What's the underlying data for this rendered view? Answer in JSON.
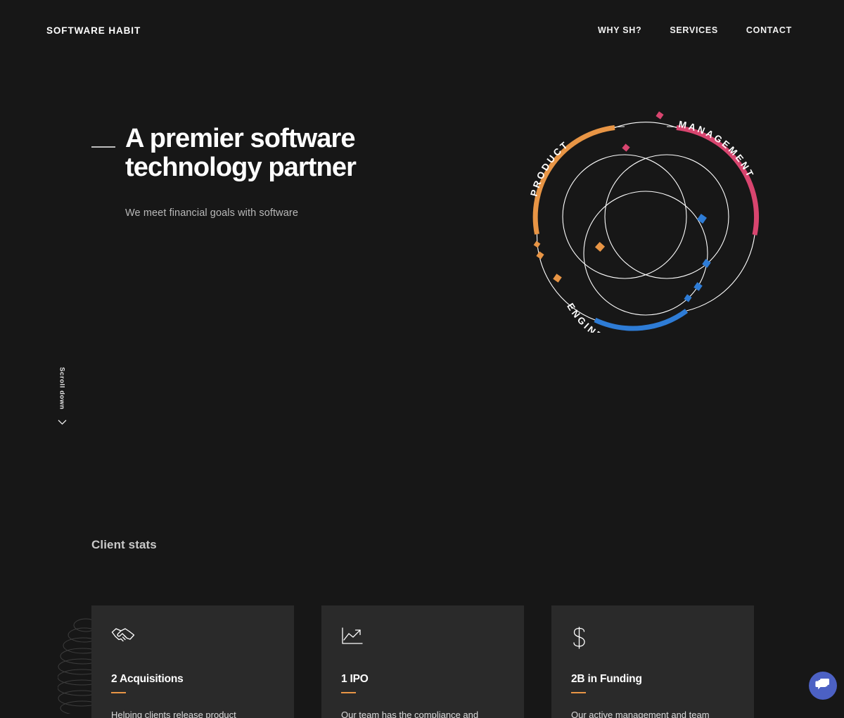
{
  "theme": {
    "page_bg": "#171717",
    "card_bg": "#2a2a2a",
    "accent_orange": "#e89545",
    "accent_pink": "#d8456f",
    "accent_blue": "#2e7cd6",
    "chat_bubble_blue": "#4c61c4",
    "text_primary": "#ffffff",
    "text_muted": "#b9b9b9"
  },
  "header": {
    "logo": "SOFTWARE HABIT",
    "nav": [
      {
        "label": "WHY SH?"
      },
      {
        "label": "SERVICES"
      },
      {
        "label": "CONTACT"
      }
    ]
  },
  "hero": {
    "headline_line1": "A premier software",
    "headline_line2": "technology partner",
    "subhead": "We meet financial goals with software",
    "scroll_down_label": "Scroll down",
    "scroll_down_icon": "chevron-down-icon",
    "diagram": {
      "name": "venn-diagram",
      "labels": [
        {
          "text": "PRODUCT",
          "arc_color": "#e89545"
        },
        {
          "text": "MANAGEMENT",
          "arc_color": "#d8456f"
        },
        {
          "text": "ENGINEERING",
          "arc_color": "#2e7cd6"
        }
      ]
    }
  },
  "stats": {
    "title": "Client stats",
    "cards": [
      {
        "icon": "handshake-icon",
        "heading": "2 Acquisitions",
        "body": "Helping clients release product"
      },
      {
        "icon": "chart-trend-up-icon",
        "heading": "1 IPO",
        "body": "Our team has the compliance and"
      },
      {
        "icon": "dollar-sign-icon",
        "heading": "2B in Funding",
        "body": "Our active management and team"
      }
    ]
  },
  "chat": {
    "icon": "chat-bubbles-icon",
    "label": "Open chat"
  }
}
